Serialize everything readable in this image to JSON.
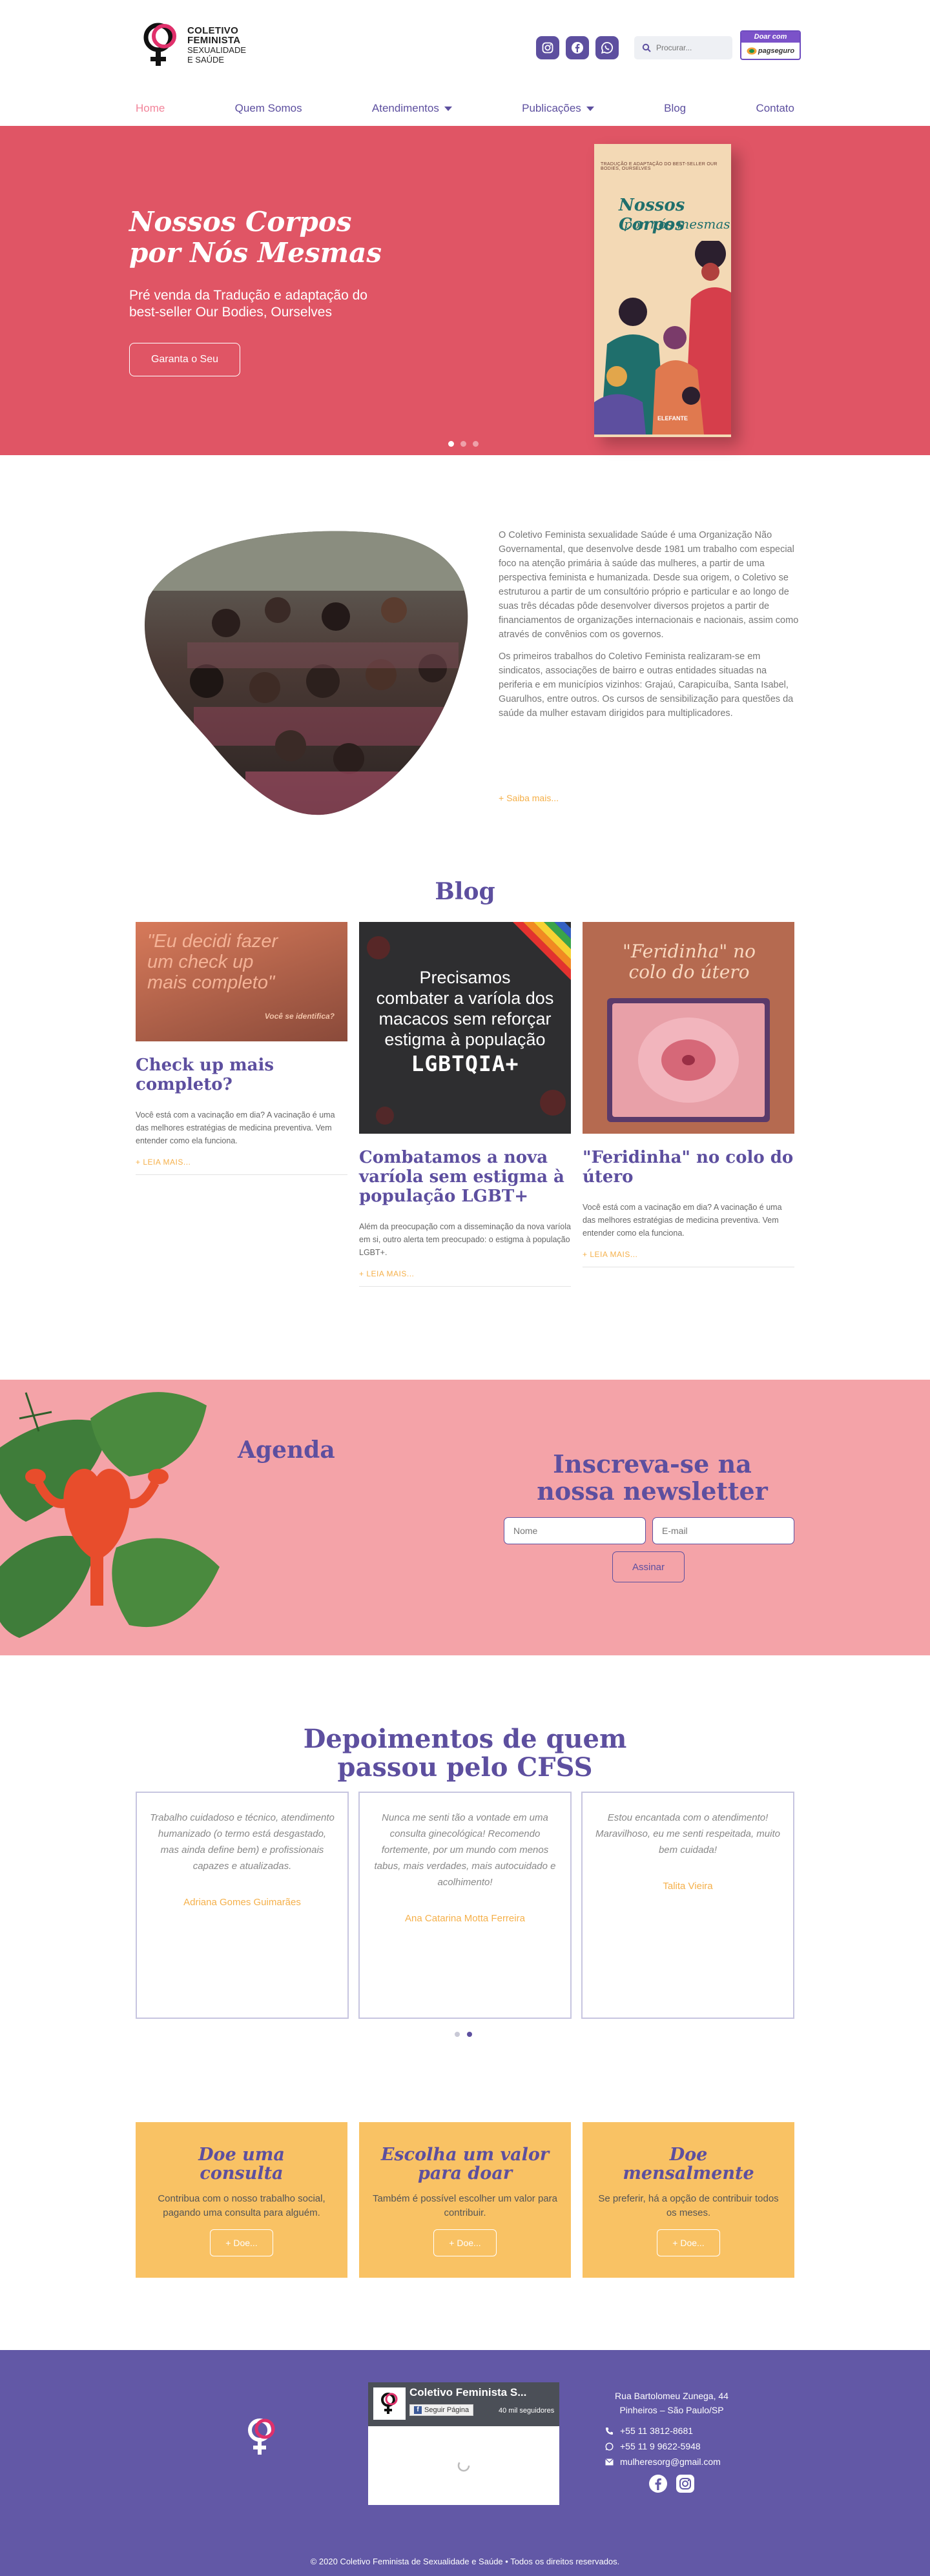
{
  "header": {
    "logo": {
      "line1": "COLETIVO",
      "line2": "FEMINISTA",
      "line3": "SEXUALIDADE",
      "line4": "E SAÚDE"
    },
    "search_placeholder": "Procurar...",
    "donate": {
      "top": "Doar com",
      "bottom": "pagseguro"
    },
    "social_icons": [
      "instagram-icon",
      "facebook-icon",
      "whatsapp-icon"
    ],
    "nav": [
      {
        "label": "Home",
        "active": true
      },
      {
        "label": "Quem Somos"
      },
      {
        "label": "Atendimentos",
        "dropdown": true
      },
      {
        "label": "Publicações",
        "dropdown": true
      },
      {
        "label": "Blog"
      },
      {
        "label": "Contato"
      }
    ]
  },
  "hero": {
    "title_line1": "Nossos Corpos",
    "title_line2": "por Nós Mesmas",
    "subtitle": "Pré venda da Tradução e adaptação do best-seller Our Bodies, Ourselves",
    "button": "Garanta o Seu",
    "book": {
      "top_text": "TRADUÇÃO E ADAPTAÇÃO DO BEST-SELLER OUR BODIES, OURSELVES",
      "title1": "Nossos Corpos",
      "title2": "por nós mesmas",
      "publisher": "ELEFANTE"
    },
    "slides": 3,
    "active_slide": 0
  },
  "about": {
    "p1": "O Coletivo Feminista sexualidade Saúde é uma Organização Não Governamental, que desenvolve desde 1981 um trabalho com especial foco na atenção primária à saúde das mulheres, a partir de uma perspectiva feminista e humanizada. Desde sua origem, o Coletivo se estruturou a partir de um consultório próprio e particular e ao longo de suas três décadas pôde desenvolver diversos projetos a partir de financiamentos de organizações internacionais e nacionais, assim como através de convênios com os governos.",
    "p2": "Os primeiros trabalhos do Coletivo Feminista realizaram-se em sindicatos, associações de bairro e outras entidades situadas na periferia e em municípios vizinhos: Grajaú, Carapicuíba, Santa Isabel, Guarulhos, entre outros. Os cursos de sensibilização para questões da saúde da mulher estavam dirigidos para multiplicadores.",
    "more": "+ Saiba mais..."
  },
  "blog": {
    "title": "Blog",
    "posts": [
      {
        "img_text": "\"Eu decidi fazer um check up mais completo\"",
        "img_sub": "Você se identifica?",
        "title": "Check up mais completo?",
        "excerpt": "Você está com a vacinação em dia? A vacinação é uma das melhores estratégias de medicina preventiva. Vem entender como ela funciona.",
        "more": "+ LEIA MAIS..."
      },
      {
        "img_line1": "Precisamos",
        "img_line2": "combater a varíola dos",
        "img_line3": "macacos sem reforçar",
        "img_line4": "estigma à população",
        "img_line5": "LGBTQIA+",
        "title": "Combatamos a nova varíola sem estigma à população LGBT+",
        "excerpt": "Além da preocupação com a disseminação da nova varíola em si, outro alerta tem preocupado: o estigma à população LGBT+.",
        "more": "+ LEIA MAIS..."
      },
      {
        "img_text": "\"Feridinha\" no colo do útero",
        "title": "\"Feridinha\" no colo do útero",
        "excerpt": "Você está com a vacinação em dia? A vacinação é uma das melhores estratégias de medicina preventiva. Vem entender como ela funciona.",
        "more": "+ LEIA MAIS..."
      }
    ]
  },
  "agenda": {
    "title": "Agenda"
  },
  "newsletter": {
    "title_line1": "Inscreva-se na",
    "title_line2": "nossa newsletter",
    "name_placeholder": "Nome",
    "email_placeholder": "E-mail",
    "button": "Assinar"
  },
  "testimonials": {
    "title_line1": "Depoimentos de quem",
    "title_line2": "passou pelo CFSS",
    "items": [
      {
        "quote": "Trabalho cuidadoso e técnico, atendimento humanizado (o termo está desgastado, mas ainda define bem) e profissionais capazes e atualizadas.",
        "author": "Adriana Gomes Guimarães"
      },
      {
        "quote": "Nunca me senti tão a vontade em uma consulta ginecológica! Recomendo fortemente, por um mundo com menos tabus, mais verdades, mais autocuidado e acolhimento!",
        "author": "Ana Catarina Motta Ferreira"
      },
      {
        "quote": "Estou encantada com o atendimento! Maravilhoso, eu me senti respeitada, muito bem cuidada!",
        "author": "Talita Vieira"
      }
    ],
    "pages": 2,
    "active_page": 1
  },
  "donate": {
    "cards": [
      {
        "title_line1": "Doe uma",
        "title_line2": "consulta",
        "text": "Contribua com o nosso trabalho social, pagando uma consulta para alguém.",
        "button": "+ Doe..."
      },
      {
        "title_line1": "Escolha um valor",
        "title_line2": "para doar",
        "text": "Também é possível escolher um valor para contribuir.",
        "button": "+ Doe..."
      },
      {
        "title_line1": "Doe",
        "title_line2": "mensalmente",
        "text": "Se preferir, há a opção de contribuir todos os meses.",
        "button": "+ Doe..."
      }
    ]
  },
  "footer": {
    "fb": {
      "name": "Coletivo Feminista S...",
      "follow": "Seguir Página",
      "count": "40 mil seguidores"
    },
    "address1": "Rua Bartolomeu Zunega, 44",
    "address2": "Pinheiros – São Paulo/SP",
    "phone": "+55 11 3812-8681",
    "whatsapp": "+55 11 9 9622-5948",
    "email": "mulheresorg@gmail.com",
    "copyright": "© 2020 Coletivo Feminista de Sexualidade e Saúde • Todos os direitos reservados."
  },
  "colors": {
    "purple": "#5d4f9f",
    "hero_red": "#e05565",
    "pink_band": "#f4a3a8",
    "orange_accent": "#f5b04a",
    "donate_yellow": "#f9c264",
    "footer_purple": "#6258a6"
  }
}
